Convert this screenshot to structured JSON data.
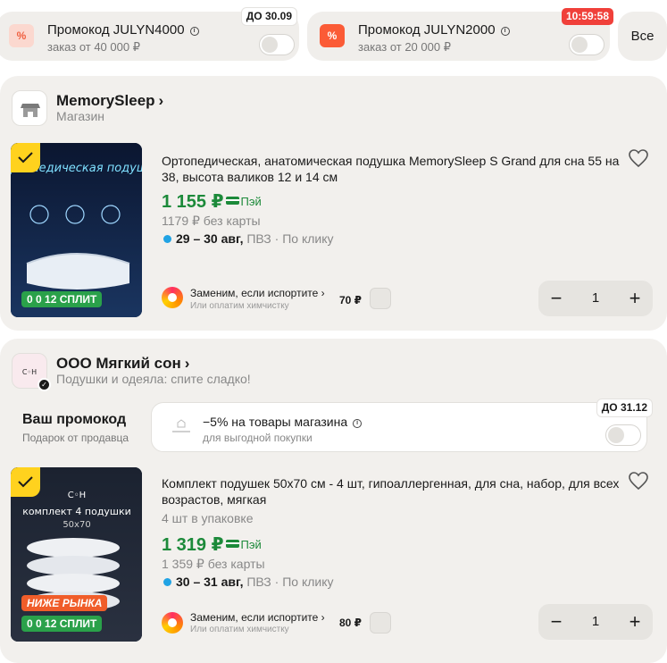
{
  "promos": [
    {
      "icon": "%",
      "title": "Промокод JULYN4000",
      "subtitle": "заказ от 40 000 ₽",
      "badge": "ДО 30.09"
    },
    {
      "icon": "%",
      "title": "Промокод JULYN2000",
      "subtitle": "заказ от 20 000 ₽",
      "badge": "10:59:58"
    }
  ],
  "all_label": "Все",
  "shops": [
    {
      "name": "MemorySleep",
      "chevron": "›",
      "subtitle": "Магазин",
      "item": {
        "title": "Ортопедическая, анатомическая подушка MemorySleep S Grand для сна 55 на 38, высота валиков 12 и 14 см",
        "price": "1 155 ₽",
        "pay_label": "Пэй",
        "old_price": "1179 ₽ без карты",
        "delivery_dates": "29 – 30 авг,",
        "delivery_rest": " ПВЗ · По клику",
        "img_label": "0 0 12 СПЛИТ",
        "img_text": "ортопедическая подушка",
        "replace_title": "Заменим, если испортите ›",
        "replace_sub": "Или оплатим химчистку",
        "replace_price": "70 ₽",
        "quantity": "1"
      }
    },
    {
      "name": "ООО Мягкий сон",
      "chevron": "›",
      "subtitle": "Подушки и одеяла: спите сладко!",
      "logo_text": "С◦Н",
      "your_promo_title": "Ваш промокод",
      "your_promo_sub": "Подарок от продавца",
      "shop_promo": {
        "title": "−5% на товары магазина",
        "subtitle": "для выгодной покупки",
        "badge": "ДО 31.12"
      },
      "item": {
        "title": "Комплект подушек 50х70 см - 4 шт, гипоаллергенная, для сна, набор, для всех возрастов, мягкая",
        "pack": "4 шт в упаковке",
        "price": "1 319 ₽",
        "pay_label": "Пэй",
        "old_price": "1 359 ₽ без карты",
        "delivery_dates": "30 – 31 авг,",
        "delivery_rest": " ПВЗ · По клику",
        "img_label_top": "НИЖЕ РЫНКА",
        "img_label": "0 0 12 СПЛИТ",
        "img_text": "комплект 4 подушки",
        "img_size": "50х70",
        "replace_title": "Заменим, если испортите ›",
        "replace_sub": "Или оплатим химчистку",
        "replace_price": "80 ₽",
        "quantity": "1"
      }
    }
  ],
  "colors": {
    "price_green": "#1c8a3a",
    "badge_red": "#f0403a",
    "check_yellow": "#ffd21e",
    "card_bg": "#f2f0ed",
    "delivery_dot": "#21a3e4"
  }
}
